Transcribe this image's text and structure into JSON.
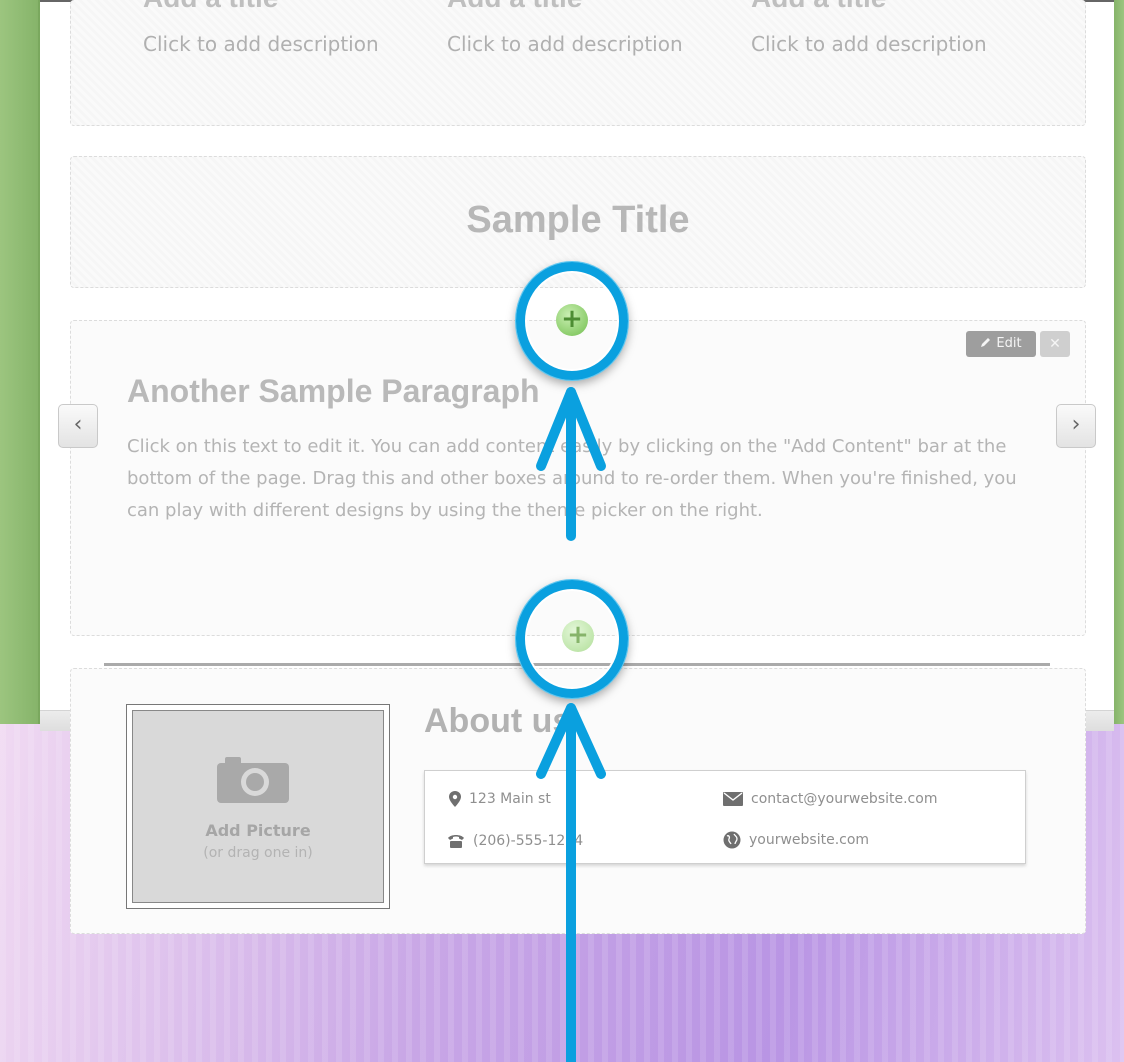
{
  "features": [
    {
      "title": "Add a title",
      "description": "Click to add description"
    },
    {
      "title": "Add a title",
      "description": "Click to add description"
    },
    {
      "title": "Add a title",
      "description": "Click to add description"
    }
  ],
  "sample_title": "Sample Title",
  "paragraph": {
    "title": "Another Sample Paragraph",
    "text": "Click on this text to edit it. You can add content easily by clicking on the \"Add Content\" bar at the bottom of the page. Drag this and other boxes around to re-order them. When you're finished, you can play with different designs by using the theme picker on the right.",
    "edit_label": "Edit",
    "delete_label": "✕"
  },
  "nav": {
    "prev": "‹",
    "next": "›"
  },
  "add_content": {
    "symbol": "+"
  },
  "about": {
    "title": "About us",
    "picture_label": "Add Picture",
    "picture_hint": "(or drag one in)",
    "address": "123 Main st",
    "phone": "(206)-555-1234",
    "email": "contact@yourwebsite.com",
    "website": "yourwebsite.com"
  },
  "annotation_color": "#0aa0df",
  "icons": [
    "plus-icon",
    "pencil-icon",
    "close-icon",
    "chevron-left-icon",
    "chevron-right-icon",
    "camera-icon",
    "map-pin-icon",
    "phone-icon",
    "envelope-icon",
    "globe-icon"
  ]
}
